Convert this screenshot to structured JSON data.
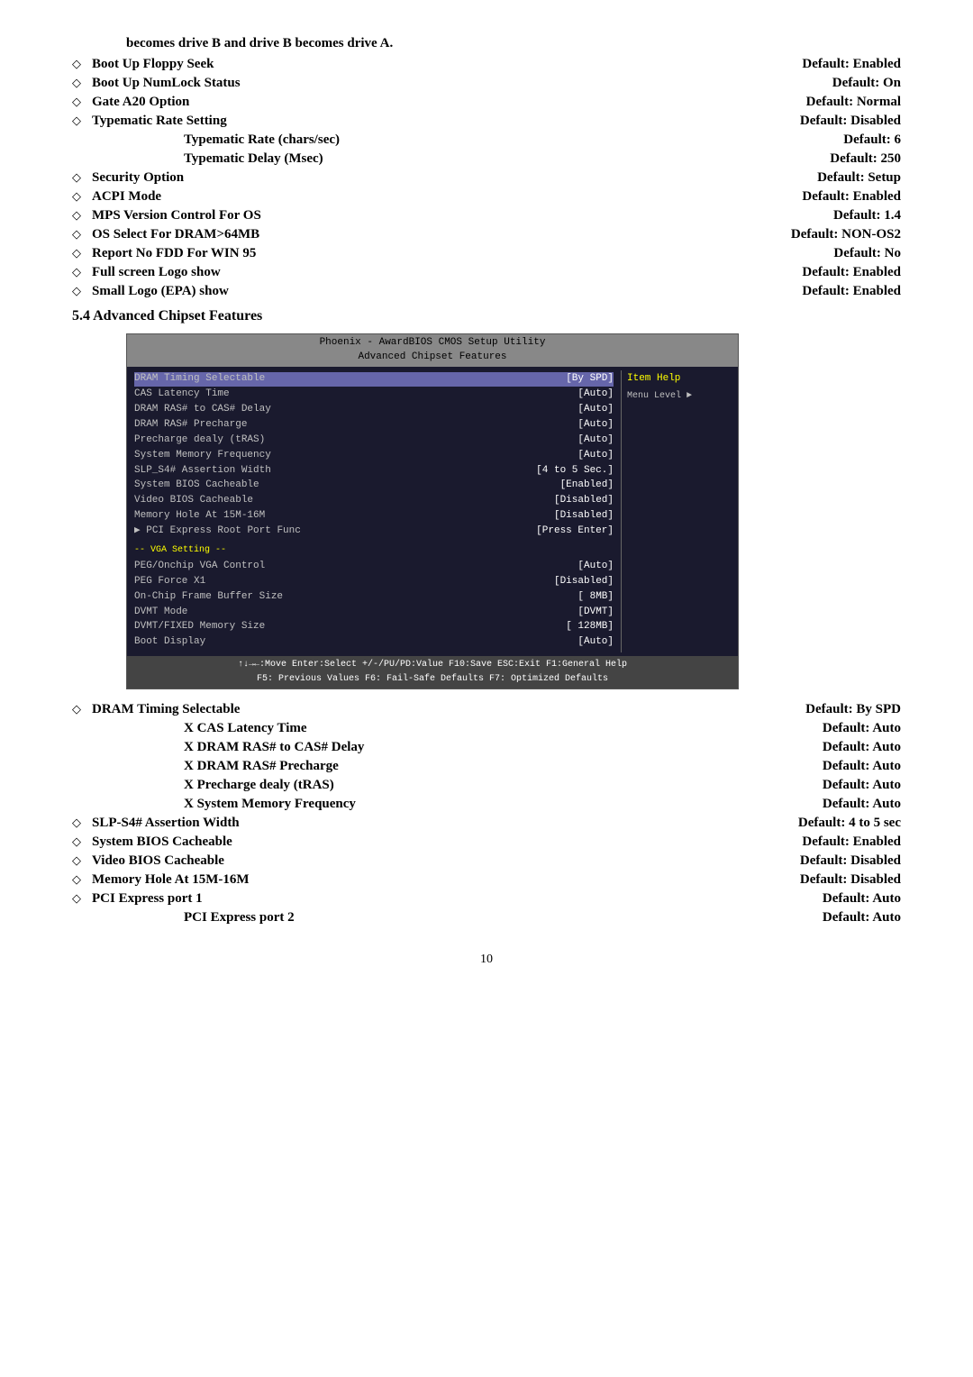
{
  "intro": {
    "text": "becomes drive B and drive B becomes drive A."
  },
  "items_top": [
    {
      "diamond": true,
      "label": "Boot Up Floppy Seek",
      "default": "Default: Enabled"
    },
    {
      "diamond": true,
      "label": "Boot Up NumLock Status",
      "default": "Default: On"
    },
    {
      "diamond": true,
      "label": "Gate A20 Option",
      "default": "Default: Normal"
    },
    {
      "diamond": true,
      "label": "Typematic Rate Setting",
      "default": "Default: Disabled"
    },
    {
      "diamond": false,
      "indent": true,
      "label": "Typematic Rate (chars/sec)",
      "default": "Default: 6"
    },
    {
      "diamond": false,
      "indent": true,
      "label": "Typematic Delay (Msec)",
      "default": "Default: 250"
    },
    {
      "diamond": true,
      "label": "Security Option",
      "default": "Default: Setup"
    },
    {
      "diamond": true,
      "label": "ACPI Mode",
      "default": "Default: Enabled"
    },
    {
      "diamond": true,
      "label": "MPS Version Control For OS",
      "default": "Default: 1.4"
    },
    {
      "diamond": true,
      "label": "OS Select For DRAM>64MB",
      "default": "Default: NON-OS2"
    },
    {
      "diamond": true,
      "label": "Report No FDD For WIN 95",
      "default": "Default: No"
    },
    {
      "diamond": true,
      "label": "Full screen Logo show",
      "default": "Default: Enabled"
    },
    {
      "diamond": true,
      "label": "Small Logo (EPA) show",
      "default": "Default: Enabled"
    }
  ],
  "section_heading": "5.4 Advanced Chipset Features",
  "bios": {
    "title1": "Phoenix - AwardBIOS CMOS Setup Utility",
    "title2": "Advanced Chipset Features",
    "rows": [
      {
        "label": "DRAM Timing Selectable",
        "value": "[By SPD]",
        "selected": true
      },
      {
        "label": "CAS Latency Time",
        "value": "[Auto]"
      },
      {
        "label": "DRAM RAS# to CAS# Delay",
        "value": "[Auto]"
      },
      {
        "label": "DRAM RAS# Precharge",
        "value": "[Auto]"
      },
      {
        "label": "Precharge dealy (tRAS)",
        "value": "[Auto]"
      },
      {
        "label": "System Memory Frequency",
        "value": "[Auto]"
      },
      {
        "label": "SLP_S4# Assertion Width",
        "value": "[4 to 5 Sec.]"
      },
      {
        "label": "System BIOS Cacheable",
        "value": "[Enabled]"
      },
      {
        "label": "Video BIOS Cacheable",
        "value": "[Disabled]"
      },
      {
        "label": "Memory Hole At 15M-16M",
        "value": "[Disabled]"
      },
      {
        "label": "▶ PCI Express Root Port Func",
        "value": "[Press Enter]"
      }
    ],
    "section2_label": "-- VGA Setting --",
    "rows2": [
      {
        "label": "PEG/Onchip VGA Control",
        "value": "[Auto]"
      },
      {
        "label": "PEG Force X1",
        "value": "[Disabled]"
      },
      {
        "label": "On-Chip Frame Buffer Size",
        "value": "[ 8MB]"
      },
      {
        "label": "DVMT Mode",
        "value": "[DVMT]"
      },
      {
        "label": "DVMT/FIXED Memory Size",
        "value": "[ 128MB]"
      },
      {
        "label": "Boot Display",
        "value": "[Auto]"
      }
    ],
    "help_title": "Item Help",
    "help_menu": "Menu Level  ►",
    "footer1": "↑↓→←:Move  Enter:Select  +/-/PU/PD:Value  F10:Save  ESC:Exit  F1:General Help",
    "footer2": "F5: Previous Values    F6: Fail-Safe Defaults    F7: Optimized Defaults"
  },
  "items_bottom": [
    {
      "diamond": true,
      "label": "DRAM Timing Selectable",
      "default": "Default: By SPD"
    },
    {
      "diamond": false,
      "indent": true,
      "label": "X CAS Latency Time",
      "default": "Default: Auto"
    },
    {
      "diamond": false,
      "indent": true,
      "label": "X DRAM RAS# to CAS# Delay",
      "default": "Default: Auto"
    },
    {
      "diamond": false,
      "indent": true,
      "label": "X DRAM RAS# Precharge",
      "default": "Default: Auto"
    },
    {
      "diamond": false,
      "indent": true,
      "label": "X Precharge dealy (tRAS)",
      "default": "Default: Auto"
    },
    {
      "diamond": false,
      "indent": true,
      "label": "X System Memory Frequency",
      "default": "Default: Auto"
    },
    {
      "diamond": true,
      "label": "SLP-S4# Assertion Width",
      "default": "Default: 4 to 5 sec"
    },
    {
      "diamond": true,
      "label": "System BIOS Cacheable",
      "default": "Default: Enabled"
    },
    {
      "diamond": true,
      "label": "Video BIOS Cacheable",
      "default": "Default: Disabled"
    },
    {
      "diamond": true,
      "label": "Memory Hole At 15M-16M",
      "default": "Default: Disabled"
    },
    {
      "diamond": true,
      "label": "PCI Express port 1",
      "default": "Default: Auto"
    },
    {
      "diamond": false,
      "indent": true,
      "label": "PCI Express port 2",
      "default": "Default: Auto"
    }
  ],
  "page_number": "10",
  "symbols": {
    "diamond": "◇"
  }
}
